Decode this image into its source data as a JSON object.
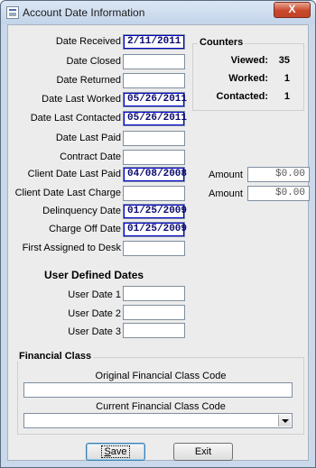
{
  "window": {
    "title": "Account Date Information",
    "close_label": "X"
  },
  "dates": [
    {
      "label": "Date Received",
      "value": "2/11/2011",
      "highlight": true
    },
    {
      "label": "Date Closed",
      "value": "",
      "highlight": false
    },
    {
      "label": "Date Returned",
      "value": "",
      "highlight": false
    },
    {
      "label": "Date Last Worked",
      "value": "05/26/2011",
      "highlight": true
    },
    {
      "label": "Date Last Contacted",
      "value": "05/26/2011",
      "highlight": true
    },
    {
      "label": "Date Last Paid",
      "value": "",
      "highlight": false
    },
    {
      "label": "Contract Date",
      "value": "",
      "highlight": false
    },
    {
      "label": "Client Date Last Paid",
      "value": "04/08/2008",
      "highlight": true
    },
    {
      "label": "Client Date Last Charge",
      "value": "",
      "highlight": false
    },
    {
      "label": "Delinquency Date",
      "value": "01/25/2009",
      "highlight": true
    },
    {
      "label": "Charge Off Date",
      "value": "01/25/2009",
      "highlight": true
    },
    {
      "label": "First Assigned to Desk",
      "value": "",
      "highlight": false
    }
  ],
  "amounts": [
    {
      "label": "Amount",
      "value": "$0.00"
    },
    {
      "label": "Amount",
      "value": "$0.00"
    }
  ],
  "counters": {
    "title": "Counters",
    "items": [
      {
        "label": "Viewed:",
        "value": "35"
      },
      {
        "label": "Worked:",
        "value": "1"
      },
      {
        "label": "Contacted:",
        "value": "1"
      }
    ]
  },
  "user_dates": {
    "title": "User Defined Dates",
    "items": [
      {
        "label": "User Date 1",
        "value": ""
      },
      {
        "label": "User Date 2",
        "value": ""
      },
      {
        "label": "User Date 3",
        "value": ""
      }
    ]
  },
  "financial_class": {
    "title": "Financial Class",
    "original_label": "Original Financial Class Code",
    "original_value": "",
    "current_label": "Current Financial Class Code",
    "current_value": ""
  },
  "buttons": {
    "save_prefix": "",
    "save_mnemonic": "S",
    "save_rest": "ave",
    "exit": "Exit"
  }
}
